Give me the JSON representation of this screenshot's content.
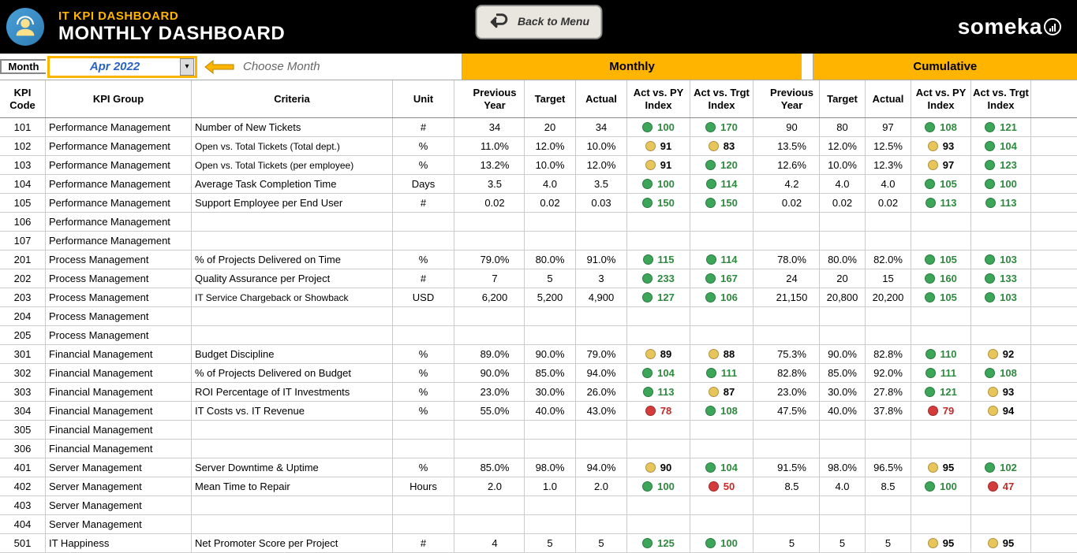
{
  "header": {
    "app_title": "IT KPI DASHBOARD",
    "page_title": "MONTHLY DASHBOARD",
    "back_button": "Back to Menu",
    "brand": "someka"
  },
  "month_picker": {
    "label": "Month",
    "value": "Apr 2022",
    "hint": "Choose Month"
  },
  "sections": {
    "monthly": "Monthly",
    "cumulative": "Cumulative"
  },
  "columns": {
    "code": "KPI Code",
    "group": "KPI Group",
    "criteria": "Criteria",
    "unit": "Unit",
    "py": "Previous Year",
    "target": "Target",
    "actual": "Actual",
    "idx_py": "Act vs. PY Index",
    "idx_tgt": "Act vs. Trgt Index"
  },
  "rows": [
    {
      "code": "101",
      "group": "Performance Management",
      "criteria": "Number of New Tickets",
      "unit": "#",
      "m": {
        "py": "34",
        "tgt": "20",
        "act": "34",
        "i1": {
          "v": "100",
          "c": "g"
        },
        "i2": {
          "v": "170",
          "c": "g"
        }
      },
      "c": {
        "py": "90",
        "tgt": "80",
        "act": "97",
        "i1": {
          "v": "108",
          "c": "g"
        },
        "i2": {
          "v": "121",
          "c": "g"
        }
      }
    },
    {
      "code": "102",
      "group": "Performance Management",
      "criteria": "Open vs. Total Tickets (Total dept.)",
      "unit": "%",
      "small": true,
      "m": {
        "py": "11.0%",
        "tgt": "12.0%",
        "act": "10.0%",
        "i1": {
          "v": "91",
          "c": "y"
        },
        "i2": {
          "v": "83",
          "c": "y"
        }
      },
      "c": {
        "py": "13.5%",
        "tgt": "12.0%",
        "act": "12.5%",
        "i1": {
          "v": "93",
          "c": "y"
        },
        "i2": {
          "v": "104",
          "c": "g"
        }
      }
    },
    {
      "code": "103",
      "group": "Performance Management",
      "criteria": "Open vs. Total Tickets (per employee)",
      "unit": "%",
      "small": true,
      "m": {
        "py": "13.2%",
        "tgt": "10.0%",
        "act": "12.0%",
        "i1": {
          "v": "91",
          "c": "y"
        },
        "i2": {
          "v": "120",
          "c": "g"
        }
      },
      "c": {
        "py": "12.6%",
        "tgt": "10.0%",
        "act": "12.3%",
        "i1": {
          "v": "97",
          "c": "y"
        },
        "i2": {
          "v": "123",
          "c": "g"
        }
      }
    },
    {
      "code": "104",
      "group": "Performance Management",
      "criteria": "Average Task Completion Time",
      "unit": "Days",
      "m": {
        "py": "3.5",
        "tgt": "4.0",
        "act": "3.5",
        "i1": {
          "v": "100",
          "c": "g"
        },
        "i2": {
          "v": "114",
          "c": "g"
        }
      },
      "c": {
        "py": "4.2",
        "tgt": "4.0",
        "act": "4.0",
        "i1": {
          "v": "105",
          "c": "g"
        },
        "i2": {
          "v": "100",
          "c": "g"
        }
      }
    },
    {
      "code": "105",
      "group": "Performance Management",
      "criteria": "Support Employee per End User",
      "unit": "#",
      "m": {
        "py": "0.02",
        "tgt": "0.02",
        "act": "0.03",
        "i1": {
          "v": "150",
          "c": "g"
        },
        "i2": {
          "v": "150",
          "c": "g"
        }
      },
      "c": {
        "py": "0.02",
        "tgt": "0.02",
        "act": "0.02",
        "i1": {
          "v": "113",
          "c": "g"
        },
        "i2": {
          "v": "113",
          "c": "g"
        }
      }
    },
    {
      "code": "106",
      "group": "Performance Management",
      "criteria": "",
      "unit": ""
    },
    {
      "code": "107",
      "group": "Performance Management",
      "criteria": "",
      "unit": ""
    },
    {
      "code": "201",
      "group": "Process Management",
      "criteria": "% of Projects Delivered on Time",
      "unit": "%",
      "m": {
        "py": "79.0%",
        "tgt": "80.0%",
        "act": "91.0%",
        "i1": {
          "v": "115",
          "c": "g"
        },
        "i2": {
          "v": "114",
          "c": "g"
        }
      },
      "c": {
        "py": "78.0%",
        "tgt": "80.0%",
        "act": "82.0%",
        "i1": {
          "v": "105",
          "c": "g"
        },
        "i2": {
          "v": "103",
          "c": "g"
        }
      }
    },
    {
      "code": "202",
      "group": "Process Management",
      "criteria": "Quality Assurance per Project",
      "unit": "#",
      "m": {
        "py": "7",
        "tgt": "5",
        "act": "3",
        "i1": {
          "v": "233",
          "c": "g"
        },
        "i2": {
          "v": "167",
          "c": "g"
        }
      },
      "c": {
        "py": "24",
        "tgt": "20",
        "act": "15",
        "i1": {
          "v": "160",
          "c": "g"
        },
        "i2": {
          "v": "133",
          "c": "g"
        }
      }
    },
    {
      "code": "203",
      "group": "Process Management",
      "criteria": "IT Service Chargeback or Showback",
      "unit": "USD",
      "small": true,
      "m": {
        "py": "6,200",
        "tgt": "5,200",
        "act": "4,900",
        "i1": {
          "v": "127",
          "c": "g"
        },
        "i2": {
          "v": "106",
          "c": "g"
        }
      },
      "c": {
        "py": "21,150",
        "tgt": "20,800",
        "act": "20,200",
        "i1": {
          "v": "105",
          "c": "g"
        },
        "i2": {
          "v": "103",
          "c": "g"
        }
      }
    },
    {
      "code": "204",
      "group": "Process Management",
      "criteria": "",
      "unit": ""
    },
    {
      "code": "205",
      "group": "Process Management",
      "criteria": "",
      "unit": ""
    },
    {
      "code": "301",
      "group": "Financial Management",
      "criteria": "Budget Discipline",
      "unit": "%",
      "m": {
        "py": "89.0%",
        "tgt": "90.0%",
        "act": "79.0%",
        "i1": {
          "v": "89",
          "c": "y"
        },
        "i2": {
          "v": "88",
          "c": "y"
        }
      },
      "c": {
        "py": "75.3%",
        "tgt": "90.0%",
        "act": "82.8%",
        "i1": {
          "v": "110",
          "c": "g"
        },
        "i2": {
          "v": "92",
          "c": "y"
        }
      }
    },
    {
      "code": "302",
      "group": "Financial Management",
      "criteria": "% of Projects Delivered on Budget",
      "unit": "%",
      "m": {
        "py": "90.0%",
        "tgt": "85.0%",
        "act": "94.0%",
        "i1": {
          "v": "104",
          "c": "g"
        },
        "i2": {
          "v": "111",
          "c": "g"
        }
      },
      "c": {
        "py": "82.8%",
        "tgt": "85.0%",
        "act": "92.0%",
        "i1": {
          "v": "111",
          "c": "g"
        },
        "i2": {
          "v": "108",
          "c": "g"
        }
      }
    },
    {
      "code": "303",
      "group": "Financial Management",
      "criteria": "ROI Percentage of IT Investments",
      "unit": "%",
      "m": {
        "py": "23.0%",
        "tgt": "30.0%",
        "act": "26.0%",
        "i1": {
          "v": "113",
          "c": "g"
        },
        "i2": {
          "v": "87",
          "c": "y"
        }
      },
      "c": {
        "py": "23.0%",
        "tgt": "30.0%",
        "act": "27.8%",
        "i1": {
          "v": "121",
          "c": "g"
        },
        "i2": {
          "v": "93",
          "c": "y"
        }
      }
    },
    {
      "code": "304",
      "group": "Financial Management",
      "criteria": "IT Costs vs. IT Revenue",
      "unit": "%",
      "m": {
        "py": "55.0%",
        "tgt": "40.0%",
        "act": "43.0%",
        "i1": {
          "v": "78",
          "c": "r"
        },
        "i2": {
          "v": "108",
          "c": "g"
        }
      },
      "c": {
        "py": "47.5%",
        "tgt": "40.0%",
        "act": "37.8%",
        "i1": {
          "v": "79",
          "c": "r"
        },
        "i2": {
          "v": "94",
          "c": "y"
        }
      }
    },
    {
      "code": "305",
      "group": "Financial Management",
      "criteria": "",
      "unit": ""
    },
    {
      "code": "306",
      "group": "Financial Management",
      "criteria": "",
      "unit": ""
    },
    {
      "code": "401",
      "group": "Server Management",
      "criteria": "Server Downtime & Uptime",
      "unit": "%",
      "m": {
        "py": "85.0%",
        "tgt": "98.0%",
        "act": "94.0%",
        "i1": {
          "v": "90",
          "c": "y"
        },
        "i2": {
          "v": "104",
          "c": "g"
        }
      },
      "c": {
        "py": "91.5%",
        "tgt": "98.0%",
        "act": "96.5%",
        "i1": {
          "v": "95",
          "c": "y"
        },
        "i2": {
          "v": "102",
          "c": "g"
        }
      }
    },
    {
      "code": "402",
      "group": "Server Management",
      "criteria": "Mean Time to Repair",
      "unit": "Hours",
      "m": {
        "py": "2.0",
        "tgt": "1.0",
        "act": "2.0",
        "i1": {
          "v": "100",
          "c": "g"
        },
        "i2": {
          "v": "50",
          "c": "r"
        }
      },
      "c": {
        "py": "8.5",
        "tgt": "4.0",
        "act": "8.5",
        "i1": {
          "v": "100",
          "c": "g"
        },
        "i2": {
          "v": "47",
          "c": "r"
        }
      }
    },
    {
      "code": "403",
      "group": "Server Management",
      "criteria": "",
      "unit": ""
    },
    {
      "code": "404",
      "group": "Server Management",
      "criteria": "",
      "unit": ""
    },
    {
      "code": "501",
      "group": "IT Happiness",
      "criteria": "Net Promoter Score per Project",
      "unit": "#",
      "m": {
        "py": "4",
        "tgt": "5",
        "act": "5",
        "i1": {
          "v": "125",
          "c": "g"
        },
        "i2": {
          "v": "100",
          "c": "g"
        }
      },
      "c": {
        "py": "5",
        "tgt": "5",
        "act": "5",
        "i1": {
          "v": "95",
          "c": "y"
        },
        "i2": {
          "v": "95",
          "c": "y"
        }
      }
    }
  ]
}
